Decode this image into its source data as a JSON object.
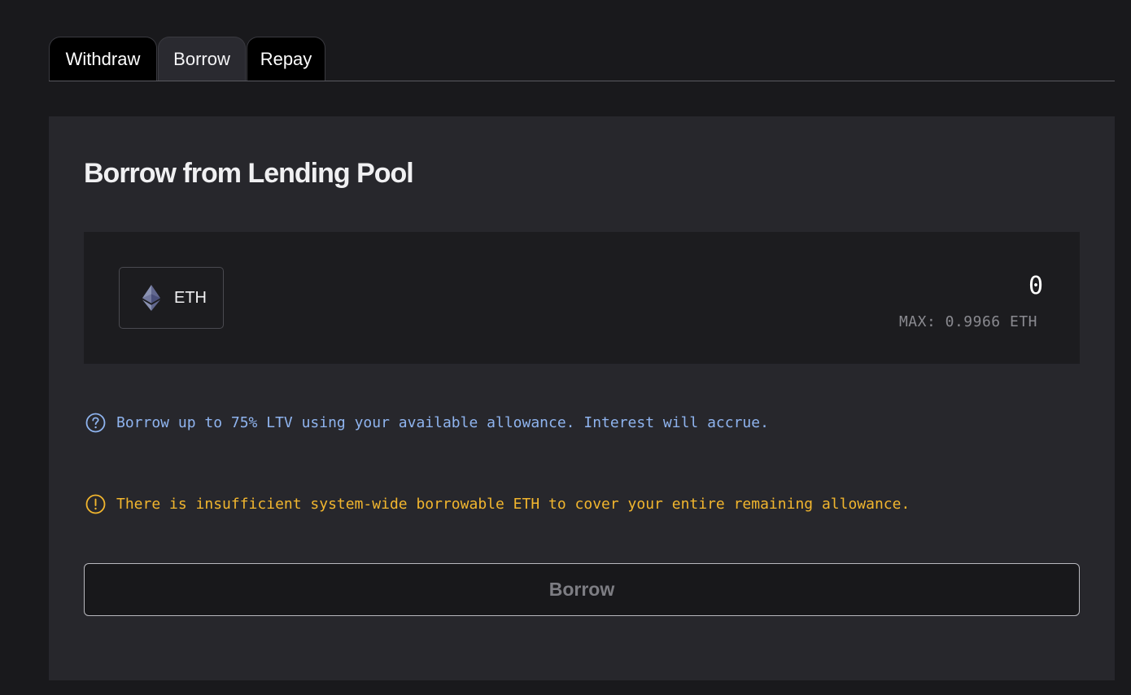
{
  "tabs": [
    {
      "label": "Withdraw",
      "active": false
    },
    {
      "label": "Borrow",
      "active": true
    },
    {
      "label": "Repay",
      "active": false
    }
  ],
  "panel": {
    "title": "Borrow from Lending Pool"
  },
  "amount_box": {
    "token_icon": "ethereum-icon",
    "token_symbol": "ETH",
    "amount_value": "0",
    "max_label": "MAX: 0.9966 ETH"
  },
  "notices": {
    "info_icon": "question-circle-icon",
    "info_text": "Borrow up to 75% LTV using your available allowance. Interest will accrue.",
    "warning_icon": "exclamation-circle-icon",
    "warning_text": "There is insufficient system-wide borrowable ETH to cover your entire remaining allowance."
  },
  "action": {
    "borrow_label": "Borrow"
  },
  "colors": {
    "background": "#19191c",
    "panel": "#27272c",
    "info": "#8fb4ef",
    "warning": "#f2b62e",
    "eth_icon": "#8a92b2"
  }
}
